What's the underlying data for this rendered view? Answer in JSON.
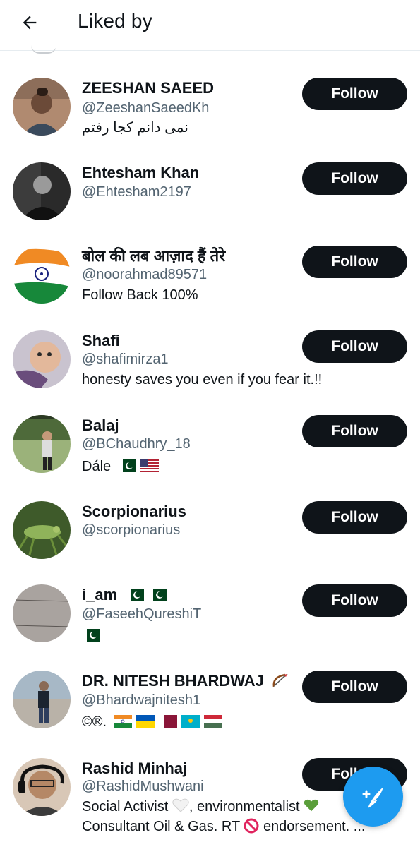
{
  "header": {
    "title": "Liked by",
    "back_icon": "arrow-left-icon"
  },
  "colors": {
    "button_bg": "#0f1419",
    "handle": "#536471",
    "fab": "#1d9bf0"
  },
  "users": [
    {
      "name": "ZEESHAN SAEED",
      "handle": "@ZeeshanSaeedKh",
      "bio": "نمی دانم کجا رفتم",
      "follow_label": "Follow"
    },
    {
      "name": "Ehtesham Khan",
      "handle": "@Ehtesham2197",
      "bio": "",
      "follow_label": "Follow"
    },
    {
      "name": "बोल की लब आज़ाद हैं तेरे",
      "handle": "@noorahmad89571",
      "bio": "Follow Back 100%",
      "follow_label": "Follow"
    },
    {
      "name": "Shafi",
      "handle": "@shafimirza1",
      "bio": "honesty saves you even if you fear it.!!",
      "follow_label": "Follow"
    },
    {
      "name": "Balaj",
      "handle": "@BChaudhry_18",
      "bio": "Dále",
      "follow_label": "Follow"
    },
    {
      "name": "Scorpionarius",
      "handle": "@scorpionarius",
      "bio": "",
      "follow_label": "Follow"
    },
    {
      "name": "i_am",
      "handle": "@FaseehQureshiT",
      "bio": "",
      "follow_label": "Follow"
    },
    {
      "name": "DR. NITESH BHARDWAJ",
      "handle": "@Bhardwajnitesh1",
      "bio": "©®.",
      "follow_label": "Follow"
    },
    {
      "name": "Rashid Minhaj",
      "handle": "@RashidMushwani",
      "bio": "Social Activist",
      "bio_2": ", environmentalist",
      "bio_line2": "Consultant Oil & Gas. RT",
      "bio_line2_end": "endorsement. ...",
      "follow_label": "Follow"
    }
  ],
  "fab": {
    "icon": "compose-tweet-icon"
  }
}
